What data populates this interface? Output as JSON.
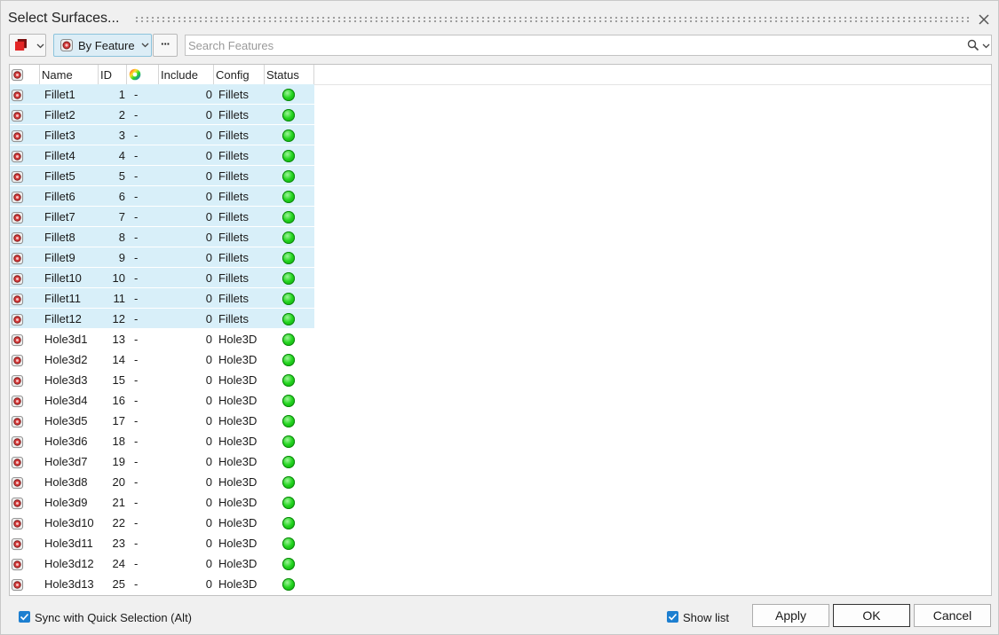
{
  "window": {
    "title": "Select Surfaces..."
  },
  "toolbar": {
    "color_swatch": "#d42020",
    "feature_mode_label": "By Feature",
    "more_label": "···",
    "search_placeholder": "Search Features",
    "search_value": ""
  },
  "table": {
    "columns": [
      "",
      "Name",
      "ID",
      "",
      "Include",
      "Config",
      "Status"
    ],
    "rows": [
      {
        "name": "Fillet1",
        "id": "1",
        "color": "-",
        "include": "0",
        "config": "Fillets",
        "selected": true
      },
      {
        "name": "Fillet2",
        "id": "2",
        "color": "-",
        "include": "0",
        "config": "Fillets",
        "selected": true
      },
      {
        "name": "Fillet3",
        "id": "3",
        "color": "-",
        "include": "0",
        "config": "Fillets",
        "selected": true
      },
      {
        "name": "Fillet4",
        "id": "4",
        "color": "-",
        "include": "0",
        "config": "Fillets",
        "selected": true
      },
      {
        "name": "Fillet5",
        "id": "5",
        "color": "-",
        "include": "0",
        "config": "Fillets",
        "selected": true
      },
      {
        "name": "Fillet6",
        "id": "6",
        "color": "-",
        "include": "0",
        "config": "Fillets",
        "selected": true
      },
      {
        "name": "Fillet7",
        "id": "7",
        "color": "-",
        "include": "0",
        "config": "Fillets",
        "selected": true
      },
      {
        "name": "Fillet8",
        "id": "8",
        "color": "-",
        "include": "0",
        "config": "Fillets",
        "selected": true
      },
      {
        "name": "Fillet9",
        "id": "9",
        "color": "-",
        "include": "0",
        "config": "Fillets",
        "selected": true
      },
      {
        "name": "Fillet10",
        "id": "10",
        "color": "-",
        "include": "0",
        "config": "Fillets",
        "selected": true
      },
      {
        "name": "Fillet11",
        "id": "11",
        "color": "-",
        "include": "0",
        "config": "Fillets",
        "selected": true
      },
      {
        "name": "Fillet12",
        "id": "12",
        "color": "-",
        "include": "0",
        "config": "Fillets",
        "selected": true
      },
      {
        "name": "Hole3d1",
        "id": "13",
        "color": "-",
        "include": "0",
        "config": "Hole3D",
        "selected": false
      },
      {
        "name": "Hole3d2",
        "id": "14",
        "color": "-",
        "include": "0",
        "config": "Hole3D",
        "selected": false
      },
      {
        "name": "Hole3d3",
        "id": "15",
        "color": "-",
        "include": "0",
        "config": "Hole3D",
        "selected": false
      },
      {
        "name": "Hole3d4",
        "id": "16",
        "color": "-",
        "include": "0",
        "config": "Hole3D",
        "selected": false
      },
      {
        "name": "Hole3d5",
        "id": "17",
        "color": "-",
        "include": "0",
        "config": "Hole3D",
        "selected": false
      },
      {
        "name": "Hole3d6",
        "id": "18",
        "color": "-",
        "include": "0",
        "config": "Hole3D",
        "selected": false
      },
      {
        "name": "Hole3d7",
        "id": "19",
        "color": "-",
        "include": "0",
        "config": "Hole3D",
        "selected": false
      },
      {
        "name": "Hole3d8",
        "id": "20",
        "color": "-",
        "include": "0",
        "config": "Hole3D",
        "selected": false
      },
      {
        "name": "Hole3d9",
        "id": "21",
        "color": "-",
        "include": "0",
        "config": "Hole3D",
        "selected": false
      },
      {
        "name": "Hole3d10",
        "id": "22",
        "color": "-",
        "include": "0",
        "config": "Hole3D",
        "selected": false
      },
      {
        "name": "Hole3d11",
        "id": "23",
        "color": "-",
        "include": "0",
        "config": "Hole3D",
        "selected": false
      },
      {
        "name": "Hole3d12",
        "id": "24",
        "color": "-",
        "include": "0",
        "config": "Hole3D",
        "selected": false
      },
      {
        "name": "Hole3d13",
        "id": "25",
        "color": "-",
        "include": "0",
        "config": "Hole3D",
        "selected": false
      }
    ],
    "status_color": "#1ecc1a",
    "selection_color": "#d8eff9"
  },
  "footer": {
    "sync_label": "Sync with Quick Selection (Alt)",
    "sync_checked": true,
    "show_list_label": "Show list",
    "show_list_checked": true,
    "apply_label": "Apply",
    "ok_label": "OK",
    "cancel_label": "Cancel"
  }
}
